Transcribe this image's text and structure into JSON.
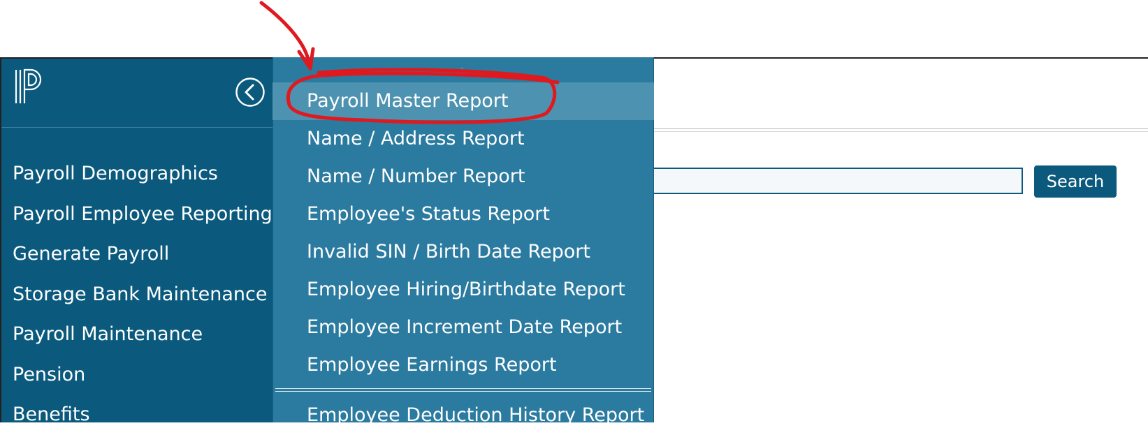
{
  "sidebar": {
    "items": [
      {
        "label": "Payroll Demographics"
      },
      {
        "label": "Payroll Employee Reporting"
      },
      {
        "label": "Generate Payroll"
      },
      {
        "label": "Storage Bank Maintenance"
      },
      {
        "label": "Payroll Maintenance"
      },
      {
        "label": "Pension"
      },
      {
        "label": "Benefits"
      }
    ]
  },
  "search": {
    "value": "",
    "button_label": "Search"
  },
  "dropdown": {
    "items": [
      {
        "label": "Payroll Master Report"
      },
      {
        "label": "Name / Address Report"
      },
      {
        "label": "Name / Number Report"
      },
      {
        "label": "Employee's Status Report"
      },
      {
        "label": "Invalid SIN / Birth Date Report"
      },
      {
        "label": "Employee Hiring/Birthdate Report"
      },
      {
        "label": "Employee Increment Date Report"
      },
      {
        "label": "Employee Earnings Report"
      }
    ],
    "after_divider": {
      "label": "Employee Deduction History Report"
    }
  },
  "colors": {
    "sidebar_bg": "#0b5a7d",
    "dropdown_bg": "#2b7a9f",
    "dropdown_active": "#4d92b0",
    "annotation": "#e0191f"
  },
  "icons": {
    "logo": "powerschool-logo-icon",
    "collapse": "chevron-left-circle-icon"
  }
}
